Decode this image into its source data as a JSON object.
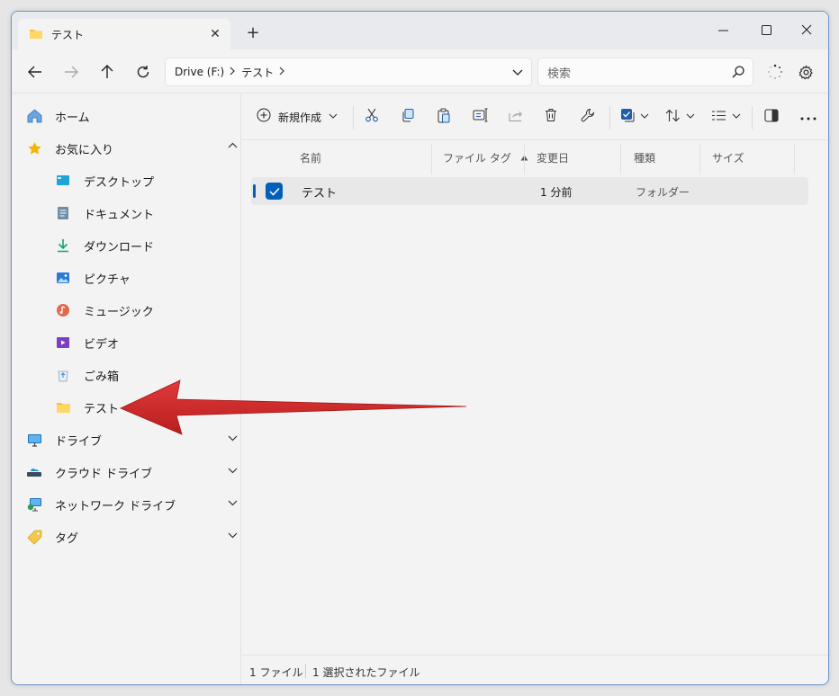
{
  "window": {
    "tab_title": "テスト",
    "new_tab_label": "+",
    "close_tab_label": "✕"
  },
  "nav": {
    "breadcrumb": [
      "Drive (F:)",
      "テスト"
    ],
    "search_placeholder": "検索"
  },
  "sidebar": {
    "items": [
      {
        "label": "ホーム",
        "icon": "home-icon"
      },
      {
        "label": "お気に入り",
        "icon": "star-icon"
      },
      {
        "label": "デスクトップ",
        "icon": "desktop-icon"
      },
      {
        "label": "ドキュメント",
        "icon": "document-icon"
      },
      {
        "label": "ダウンロード",
        "icon": "download-icon"
      },
      {
        "label": "ピクチャ",
        "icon": "picture-icon"
      },
      {
        "label": "ミュージック",
        "icon": "music-icon"
      },
      {
        "label": "ビデオ",
        "icon": "video-icon"
      },
      {
        "label": "ごみ箱",
        "icon": "recycle-bin-icon"
      },
      {
        "label": "テスト",
        "icon": "folder-icon"
      },
      {
        "label": "ドライブ",
        "icon": "drive-icon"
      },
      {
        "label": "クラウド ドライブ",
        "icon": "cloud-drive-icon"
      },
      {
        "label": "ネットワーク ドライブ",
        "icon": "network-drive-icon"
      },
      {
        "label": "タグ",
        "icon": "tag-icon"
      }
    ]
  },
  "toolbar": {
    "new_label": "新規作成"
  },
  "columns": {
    "name": "名前",
    "file_tag": "ファイル タグ",
    "modified": "変更日",
    "type": "種類",
    "size": "サイズ"
  },
  "rows": [
    {
      "name": "テスト",
      "modified": "1 分前",
      "type": "フォルダー"
    }
  ],
  "status": {
    "count": "1 ファイル",
    "selected": "1 選択されたファイル"
  },
  "colors": {
    "accent": "#005fb8",
    "folder": "#f5c242",
    "arrow": "#d22b2b"
  }
}
